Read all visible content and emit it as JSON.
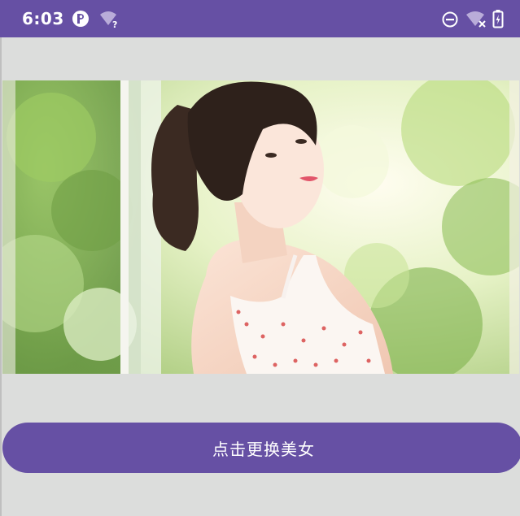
{
  "status_bar": {
    "time": "6:03",
    "background": "#6650a4",
    "icons_left": [
      "app-notification-icon",
      "wifi-unknown-icon"
    ],
    "icons_right": [
      "do-not-disturb-icon",
      "wifi-off-icon",
      "battery-charging-icon"
    ]
  },
  "image": {
    "description_icon": "photo-of-woman"
  },
  "button": {
    "label": "点击更换美女",
    "color": "#6650a4"
  }
}
